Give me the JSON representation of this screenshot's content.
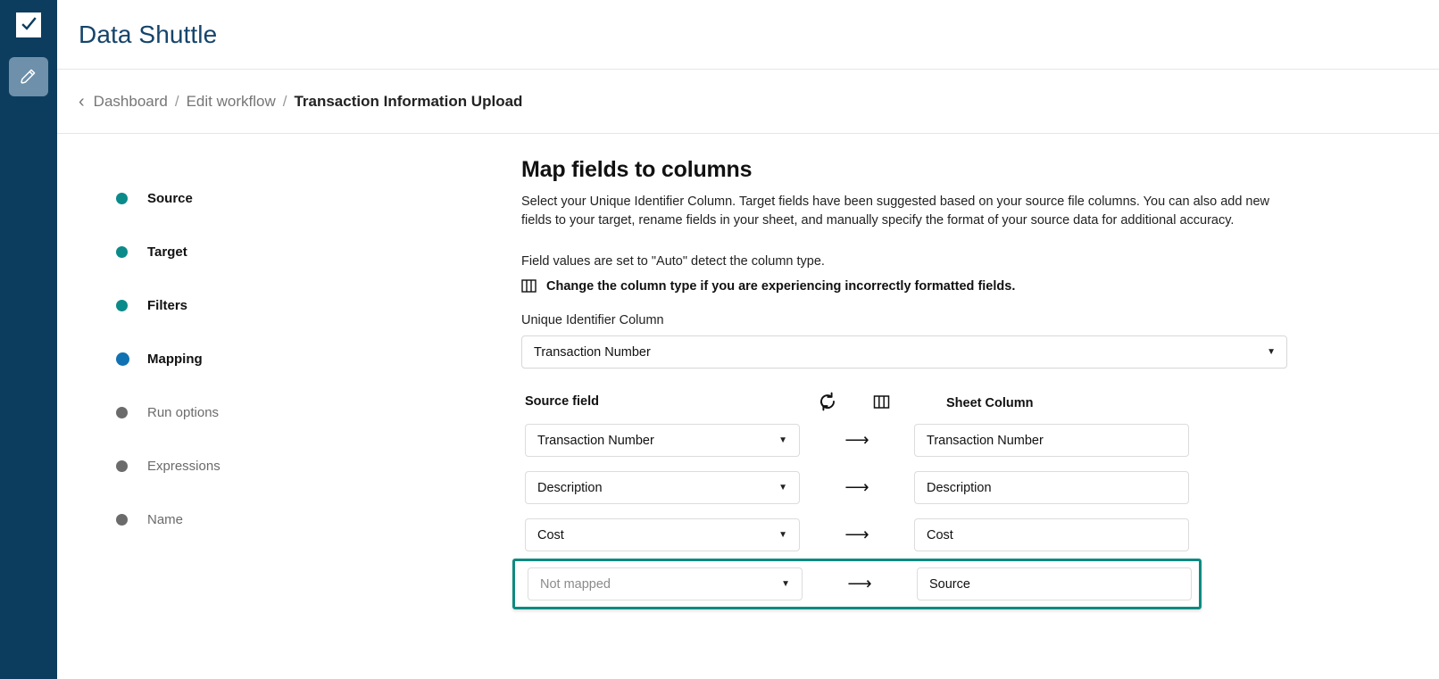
{
  "rail": {
    "logo_icon": "checkbox-check-icon",
    "edit_icon": "pencil-icon"
  },
  "header": {
    "app_title": "Data Shuttle"
  },
  "breadcrumb": {
    "back_icon": "chevron-left-icon",
    "items": [
      {
        "label": "Dashboard",
        "current": false
      },
      {
        "label": "Edit workflow",
        "current": false
      },
      {
        "label": "Transaction Information Upload",
        "current": true
      }
    ],
    "separator": "/"
  },
  "steps": [
    {
      "label": "Source",
      "state": "done"
    },
    {
      "label": "Target",
      "state": "done"
    },
    {
      "label": "Filters",
      "state": "done"
    },
    {
      "label": "Mapping",
      "state": "active"
    },
    {
      "label": "Run options",
      "state": "pending"
    },
    {
      "label": "Expressions",
      "state": "pending"
    },
    {
      "label": "Name",
      "state": "pending"
    }
  ],
  "main": {
    "title": "Map fields to columns",
    "description": "Select your Unique Identifier Column. Target fields have been suggested based on your source file columns. You can also add new fields to your target, rename fields in your sheet, and manually specify the format of your source data for additional accuracy.",
    "auto_note": "Field values are set to \"Auto\" detect the column type.",
    "type_hint_icon": "columns-icon",
    "type_hint": "Change the column type if you are experiencing incorrectly formatted fields.",
    "uid_label": "Unique Identifier Column",
    "uid_value": "Transaction Number",
    "caret_glyph": "▼",
    "table": {
      "source_header": "Source field",
      "sheet_header": "Sheet Column",
      "refresh_icon": "refresh-icon",
      "columns_icon": "columns-icon",
      "arrow_glyph": "⟶",
      "rows": [
        {
          "source": "Transaction Number",
          "source_unset": false,
          "sheet": "Transaction Number",
          "highlight": false
        },
        {
          "source": "Description",
          "source_unset": false,
          "sheet": "Description",
          "highlight": false
        },
        {
          "source": "Cost",
          "source_unset": false,
          "sheet": "Cost",
          "highlight": false
        },
        {
          "source": "Not mapped",
          "source_unset": true,
          "sheet": "Source",
          "highlight": true
        }
      ]
    }
  },
  "colors": {
    "rail_bg": "#0d3d5e",
    "rail_btn": "#6e90ab",
    "app_title": "#15446b",
    "step_done": "#0b8a8a",
    "step_active": "#1072b2",
    "step_pending": "#6b6b6b",
    "highlight_border": "#0e8a80"
  }
}
